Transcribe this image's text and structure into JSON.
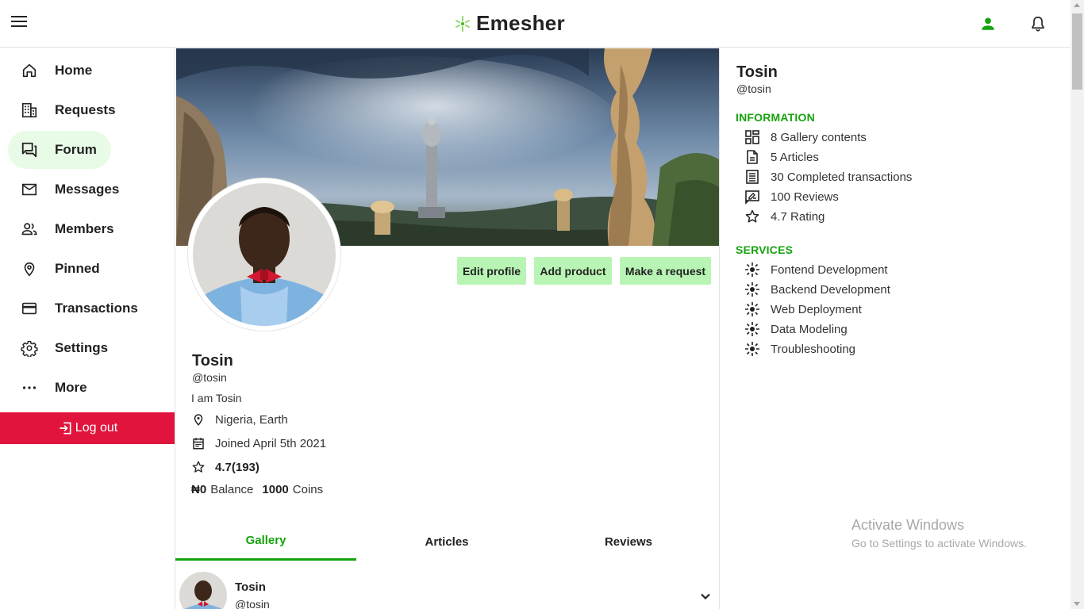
{
  "header": {
    "brand": "Emesher",
    "icons": {
      "menu": "hamburger-menu-icon",
      "user": "user-icon",
      "bell": "bell-icon"
    },
    "accent_color": "#16a30e"
  },
  "sidebar": {
    "items": [
      {
        "label": "Home",
        "icon": "home-icon"
      },
      {
        "label": "Requests",
        "icon": "building-icon"
      },
      {
        "label": "Forum",
        "icon": "forum-icon",
        "active": true
      },
      {
        "label": "Messages",
        "icon": "mail-icon"
      },
      {
        "label": "Members",
        "icon": "members-icon"
      },
      {
        "label": "Pinned",
        "icon": "pin-icon"
      },
      {
        "label": "Transactions",
        "icon": "card-icon"
      },
      {
        "label": "Settings",
        "icon": "gear-icon"
      },
      {
        "label": "More",
        "icon": "more-dots-icon"
      }
    ],
    "logout_label": "Log out",
    "logout_color": "#e0143c",
    "active_bg": "#e8fbe6"
  },
  "profile": {
    "name": "Tosin",
    "handle": "@tosin",
    "bio": "I am Tosin",
    "location": "Nigeria, Earth",
    "joined": "Joined April 5th 2021",
    "rating": "4.7(193)",
    "balance_value": "₦0",
    "balance_label": "Balance",
    "coins_value": "1000",
    "coins_label": "Coins",
    "buttons": {
      "edit": "Edit profile",
      "add_product": "Add product",
      "make_request": "Make a request"
    },
    "button_color": "#b8f5b5"
  },
  "tabs": [
    {
      "label": "Gallery",
      "active": true
    },
    {
      "label": "Articles"
    },
    {
      "label": "Reviews"
    }
  ],
  "post": {
    "name": "Tosin",
    "handle": "@tosin"
  },
  "right_panel": {
    "name": "Tosin",
    "handle": "@tosin",
    "information_title": "INFORMATION",
    "information": [
      {
        "label": "8 Gallery contents",
        "icon": "gallery-grid-icon"
      },
      {
        "label": "5 Articles",
        "icon": "document-icon"
      },
      {
        "label": "30 Completed transactions",
        "icon": "receipt-icon"
      },
      {
        "label": "100 Reviews",
        "icon": "review-icon"
      },
      {
        "label": "4.7 Rating",
        "icon": "star-icon"
      }
    ],
    "services_title": "SERVICES",
    "services": [
      {
        "label": "Fontend Development",
        "icon": "service-icon"
      },
      {
        "label": "Backend Development",
        "icon": "service-icon"
      },
      {
        "label": "Web Deployment",
        "icon": "service-icon"
      },
      {
        "label": "Data Modeling",
        "icon": "service-icon"
      },
      {
        "label": "Troubleshooting",
        "icon": "service-icon"
      }
    ]
  },
  "watermark": {
    "line1": "Activate Windows",
    "line2": "Go to Settings to activate Windows."
  }
}
